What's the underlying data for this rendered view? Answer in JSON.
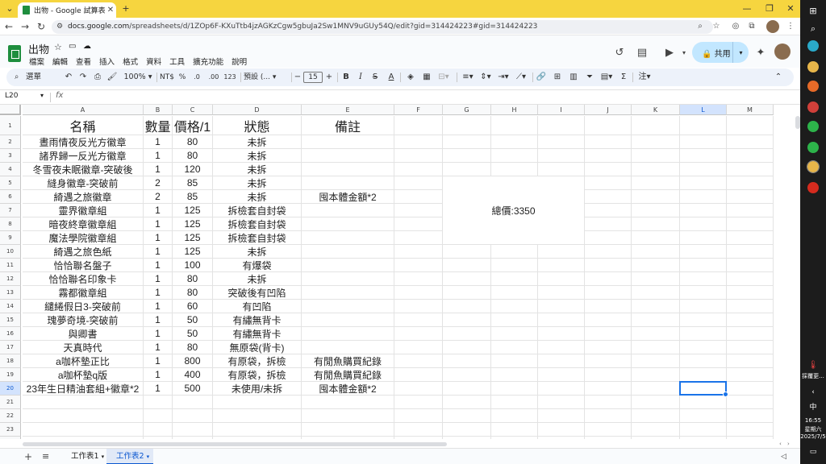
{
  "browser": {
    "tab_title": "出物 - Google 試算表",
    "url_host": "docs.google.com",
    "url_path": "/spreadsheets/d/1ZOp6F-KXuTtb4jzAGKzCgw5gbuJa2Sw1MNV9uGUy54Q/edit?gid=314424223#gid=314424223"
  },
  "doc": {
    "title": "出物",
    "menus": [
      "檔案",
      "編輯",
      "查看",
      "插入",
      "格式",
      "資料",
      "工具",
      "擴充功能",
      "說明"
    ],
    "share_label": "共用"
  },
  "toolbar": {
    "search_label": "選單",
    "zoom": "100%",
    "currency": "NT$",
    "percent": "%",
    "dec_decrease": ".0",
    "dec_increase": ".00",
    "number_format": "123",
    "font": "預設 (...",
    "font_size": "15"
  },
  "formula_bar": {
    "name_box": "L20",
    "fx": "fx",
    "content": ""
  },
  "columns": [
    "A",
    "B",
    "C",
    "D",
    "E",
    "F",
    "G",
    "H",
    "I",
    "J",
    "K",
    "L",
    "M"
  ],
  "selected_column": "L",
  "row_numbers": [
    "1",
    "2",
    "3",
    "4",
    "5",
    "6",
    "7",
    "8",
    "9",
    "10",
    "11",
    "12",
    "13",
    "14",
    "15",
    "16",
    "17",
    "18",
    "19",
    "20",
    "21",
    "22",
    "23",
    "24",
    "25"
  ],
  "selected_row": "20",
  "sheet": {
    "headers": [
      "名稱",
      "數量",
      "價格/1",
      "狀態",
      "備註"
    ],
    "rows": [
      [
        "晝雨情夜反光方徽章",
        "1",
        "80",
        "未拆",
        ""
      ],
      [
        "諸界歸一反光方徽章",
        "1",
        "80",
        "未拆",
        ""
      ],
      [
        "冬雪夜未眠徽章-突破後",
        "1",
        "120",
        "未拆",
        ""
      ],
      [
        "縫身徽章-突破前",
        "2",
        "85",
        "未拆",
        ""
      ],
      [
        "綺遇之旅徽章",
        "2",
        "85",
        "未拆",
        "囤本體金額*2"
      ],
      [
        "靈界徽章組",
        "1",
        "125",
        "拆檢套自封袋",
        ""
      ],
      [
        "暗夜終章徽章組",
        "1",
        "125",
        "拆檢套自封袋",
        ""
      ],
      [
        "魔法學院徽章組",
        "1",
        "125",
        "拆檢套自封袋",
        ""
      ],
      [
        "綺遇之旅色紙",
        "1",
        "125",
        "未拆",
        ""
      ],
      [
        "恰恰聯名盤子",
        "1",
        "100",
        "有爆袋",
        ""
      ],
      [
        "恰恰聯名印象卡",
        "1",
        "80",
        "未拆",
        ""
      ],
      [
        "霧都徽章組",
        "1",
        "80",
        "突破後有凹陷",
        ""
      ],
      [
        "繾綣假日3-突破前",
        "1",
        "60",
        "有凹陷",
        ""
      ],
      [
        "瑰夢奇境-突破前",
        "1",
        "50",
        "有繡無背卡",
        ""
      ],
      [
        "與卿書",
        "1",
        "50",
        "有繡無背卡",
        ""
      ],
      [
        "天真時代",
        "1",
        "80",
        "無原袋(背卡)",
        ""
      ],
      [
        "a咖杯墊正比",
        "1",
        "800",
        "有原袋，拆檢",
        "有閒魚購買紀錄"
      ],
      [
        "a咖杯墊q版",
        "1",
        "400",
        "有原袋，拆檢",
        "有閒魚購買紀錄"
      ],
      [
        "23年生日精油套組+徽章*2",
        "1",
        "500",
        "未使用/未拆",
        "囤本體金額*2"
      ]
    ],
    "total": "總價:3350"
  },
  "sheet_tabs": [
    {
      "label": "工作表1",
      "active": false
    },
    {
      "label": "工作表2",
      "active": true
    }
  ],
  "taskbar": {
    "weather": "採覆更...",
    "ime": "中",
    "time": "16:55",
    "weekday": "星期六",
    "date": "2025/7/5"
  }
}
